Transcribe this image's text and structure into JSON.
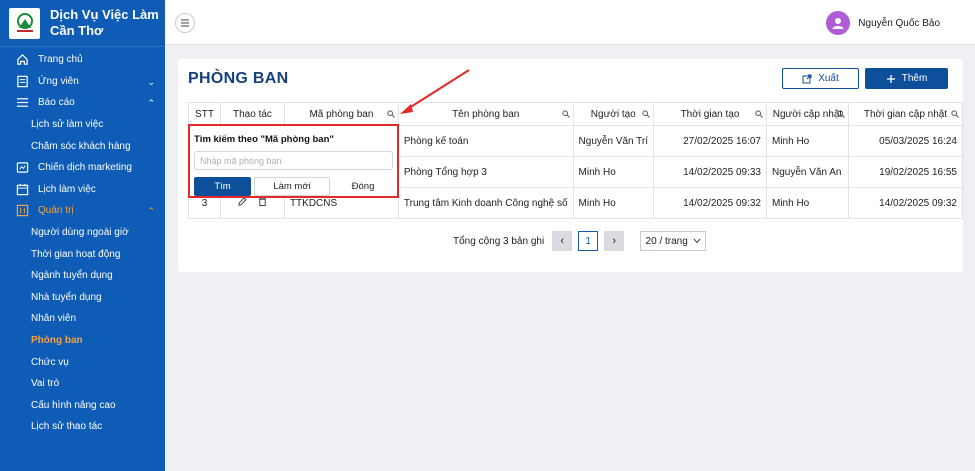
{
  "brand": {
    "title": "Dịch Vụ Việc Làm Cần Thơ"
  },
  "sidebar": {
    "items": [
      {
        "label": "Trang chủ",
        "icon": "home-icon"
      },
      {
        "label": "Ứng viên",
        "icon": "candidate-icon"
      },
      {
        "label": "Báo cáo",
        "icon": "list-icon"
      },
      {
        "label": "Lịch sử làm việc"
      },
      {
        "label": "Chăm sóc khách hàng"
      },
      {
        "label": "Chiến dịch marketing",
        "icon": "marketing-icon"
      },
      {
        "label": "Lịch làm việc",
        "icon": "calendar-icon"
      },
      {
        "label": "Quản trị",
        "icon": "admin-icon"
      },
      {
        "label": "Người dùng ngoài giờ"
      },
      {
        "label": "Thời gian hoạt động"
      },
      {
        "label": "Ngành tuyển dụng"
      },
      {
        "label": "Nhà tuyển dụng"
      },
      {
        "label": "Nhân viên"
      },
      {
        "label": "Phòng ban"
      },
      {
        "label": "Chức vụ"
      },
      {
        "label": "Vai trò"
      },
      {
        "label": "Cấu hình nâng cao"
      },
      {
        "label": "Lịch sử thao tác"
      }
    ]
  },
  "header": {
    "user_name": "Nguyễn Quốc Bảo"
  },
  "page": {
    "title": "PHÒNG BAN",
    "export_label": "Xuất",
    "add_label": "Thêm"
  },
  "table": {
    "columns": [
      "STT",
      "Thao tác",
      "Mã phòng ban",
      "Tên phòng ban",
      "Người tạo",
      "Thời gian tạo",
      "Người cập nhật",
      "Thời gian cập nhật"
    ],
    "rows": [
      {
        "stt": "",
        "code": "",
        "name": "Phòng kế toán",
        "creator": "Nguyễn Văn Trí",
        "created": "27/02/2025 16:07",
        "updater": "Minh Ho",
        "updated": "05/03/2025 16:24"
      },
      {
        "stt": "",
        "code": "",
        "name": "Phòng Tổng hợp 3",
        "creator": "Minh Ho",
        "created": "14/02/2025 09:33",
        "updater": "Nguyễn Văn An",
        "updated": "19/02/2025 16:55"
      },
      {
        "stt": "3",
        "code": "TTKDCNS",
        "name": "Trung tâm Kinh doanh Công nghệ số",
        "creator": "Minh Ho",
        "created": "14/02/2025 09:32",
        "updater": "Minh Ho",
        "updated": "14/02/2025 09:32"
      }
    ]
  },
  "pager": {
    "total": "Tổng cộng 3 bản ghi",
    "page": "1",
    "page_size": "20 / trang"
  },
  "popup": {
    "title": "Tìm kiếm theo \"Mã phòng ban\"",
    "placeholder": "Nhập mã phòng ban",
    "search_label": "Tìm",
    "reset_label": "Làm mới",
    "close_label": "Đóng"
  },
  "colors": {
    "sidebar": "#0e5cb5",
    "accent": "#0e4f9c",
    "active": "#f7a23b",
    "highlight": "#e32a2a"
  }
}
